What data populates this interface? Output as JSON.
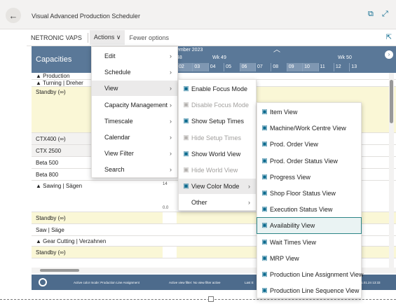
{
  "window": {
    "title": "Visual Advanced Production Scheduler"
  },
  "actionbar": {
    "app_name": "NETRONIC VAPS",
    "actions_label": "Actions",
    "actions_chevron": "chevron-down-icon",
    "fewer_label": "Fewer options"
  },
  "gantt": {
    "title": "Capacities",
    "month": "ember 2023",
    "weeks": [
      {
        "label": "48"
      },
      {
        "label": "Wk 49"
      },
      {
        "label": "Wk 50"
      }
    ],
    "days": [
      "02",
      "03",
      "04",
      "05",
      "06",
      "07",
      "08",
      "09",
      "10",
      "11",
      "12",
      "13"
    ],
    "rows": [
      {
        "label": "▲ Production",
        "kind": "group"
      },
      {
        "label": "▲ Turning | Dreher",
        "kind": "group"
      },
      {
        "label": "Standby (∞)",
        "kind": "standby"
      },
      {
        "label": "CTX400 (∞)",
        "kind": "grey"
      },
      {
        "label": "CTX 2500",
        "kind": "grey"
      },
      {
        "label": "Beta 500",
        "kind": "normal"
      },
      {
        "label": "Beta 800",
        "kind": "normal"
      },
      {
        "label": "▲ Sawing | Sägen",
        "kind": "group-tall",
        "axis_top": "14",
        "axis_bottom": "0.0"
      },
      {
        "label": "Standby (∞)",
        "kind": "standby"
      },
      {
        "label": "Saw | Säge",
        "kind": "normal"
      },
      {
        "label": "▲ Gear Cutting | Verzahnen",
        "kind": "group"
      },
      {
        "label": "Standby (∞)",
        "kind": "standby"
      }
    ],
    "status": {
      "color_mode": "Active color mode: Production Line Assignment",
      "view_filter": "Active view filter: No view filter active",
      "last": "Last E",
      "date": "1.01.24 13:33"
    }
  },
  "menu_actions": {
    "items": [
      {
        "label": "Edit",
        "has_submenu": true
      },
      {
        "label": "Schedule",
        "has_submenu": true
      },
      {
        "label": "View",
        "has_submenu": true,
        "active": true
      },
      {
        "label": "Capacity Management",
        "has_submenu": true
      },
      {
        "label": "Timescale",
        "has_submenu": true
      },
      {
        "label": "Calendar",
        "has_submenu": true
      },
      {
        "label": "View Filter",
        "has_submenu": true
      },
      {
        "label": "Search",
        "has_submenu": true
      }
    ]
  },
  "menu_view": {
    "items": [
      {
        "label": "Enable Focus Mode",
        "icon": "focus-mode-icon",
        "disabled": false
      },
      {
        "label": "Disable Focus Mode",
        "icon": "focus-mode-icon",
        "disabled": true
      },
      {
        "label": "Show Setup Times",
        "icon": "setup-times-icon",
        "disabled": false
      },
      {
        "label": "Hide Setup Times",
        "icon": "setup-times-icon",
        "disabled": true
      },
      {
        "label": "Show World View",
        "icon": "world-view-icon",
        "disabled": false
      },
      {
        "label": "Hide World View",
        "icon": "world-view-icon",
        "disabled": true
      },
      {
        "label": "View Color Mode",
        "icon": "color-mode-icon",
        "disabled": false,
        "has_submenu": true,
        "active": true
      },
      {
        "label": "Other",
        "icon": "",
        "disabled": false,
        "has_submenu": true
      }
    ]
  },
  "menu_color_mode": {
    "items": [
      {
        "label": "Item View",
        "icon": "item-icon"
      },
      {
        "label": "Machine/Work Centre View",
        "icon": "machine-icon"
      },
      {
        "label": "Prod. Order View",
        "icon": "prod-order-icon"
      },
      {
        "label": "Prod. Order Status View",
        "icon": "prod-order-status-icon"
      },
      {
        "label": "Progress View",
        "icon": "progress-icon"
      },
      {
        "label": "Shop Floor Status View",
        "icon": "shop-floor-icon"
      },
      {
        "label": "Execution Status View",
        "icon": "execution-icon"
      },
      {
        "label": "Availability View",
        "icon": "availability-icon",
        "selected": true
      },
      {
        "label": "Wait Times View",
        "icon": "wait-times-icon"
      },
      {
        "label": "MRP View",
        "icon": "mrp-icon"
      },
      {
        "label": "Production Line Assignment View",
        "icon": "line-assignment-icon"
      },
      {
        "label": "Production Line Sequence View",
        "icon": "line-sequence-icon"
      }
    ]
  },
  "colors": {
    "header": "#5a7898",
    "status": "#4d6b8c",
    "accent": "#2c8586",
    "standby": "#faf7d6"
  }
}
